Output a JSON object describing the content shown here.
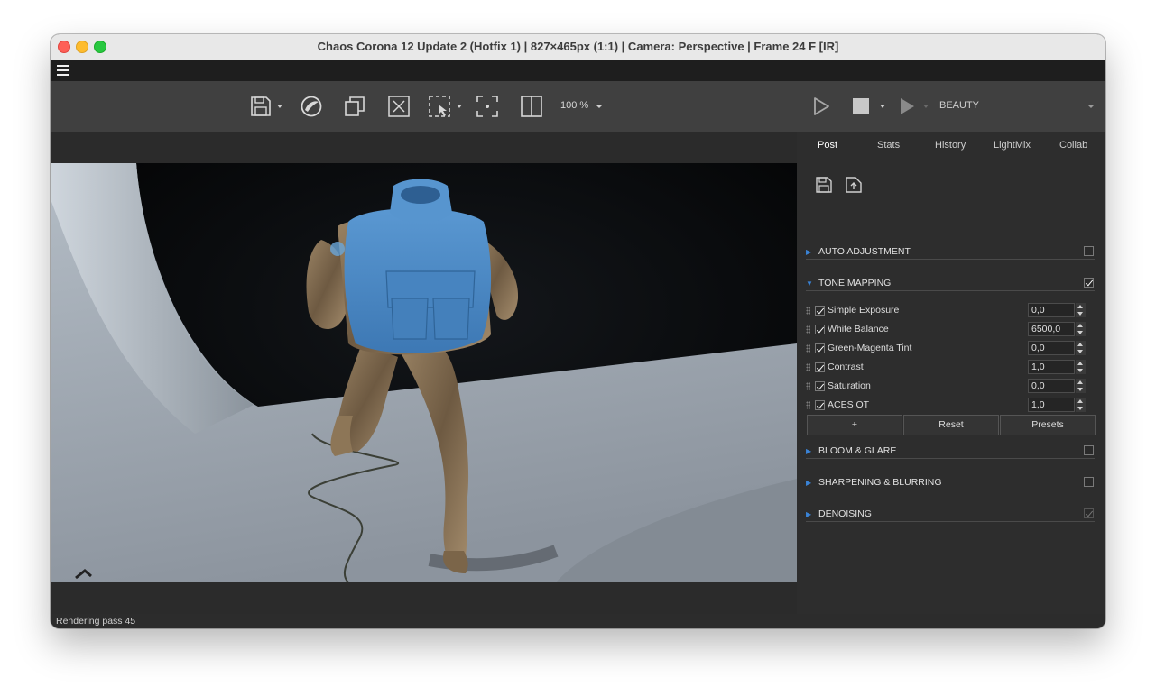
{
  "window": {
    "title": "Chaos Corona 12 Update 2 (Hotfix 1) | 827×465px (1:1) | Camera: Perspective | Frame 24 F [IR]"
  },
  "toolbar": {
    "zoom": "100 %",
    "pass": "BEAUTY",
    "icons": [
      "save-icon",
      "corona-logo-icon",
      "copy-icon",
      "clear-icon",
      "region-select-icon",
      "focus-icon",
      "compare-icon",
      "start-render-icon",
      "stop-render-icon",
      "resume-render-icon"
    ]
  },
  "panel": {
    "tabs": [
      {
        "label": "Post",
        "active": true
      },
      {
        "label": "Stats",
        "active": false
      },
      {
        "label": "History",
        "active": false
      },
      {
        "label": "LightMix",
        "active": false
      },
      {
        "label": "Collab",
        "active": false
      }
    ],
    "sections": {
      "auto_adjustment": {
        "title": "AUTO ADJUSTMENT",
        "enabled": false
      },
      "tone_mapping": {
        "title": "TONE MAPPING",
        "enabled": true
      },
      "bloom_glare": {
        "title": "BLOOM & GLARE",
        "enabled": false
      },
      "sharpening": {
        "title": "SHARPENING & BLURRING",
        "enabled": false
      },
      "denoising": {
        "title": "DENOISING",
        "enabled": true
      }
    },
    "tone_rows": [
      {
        "label": "Simple Exposure",
        "value": "0,0",
        "checked": true
      },
      {
        "label": "White Balance",
        "value": "6500,0",
        "checked": true
      },
      {
        "label": "Green-Magenta Tint",
        "value": "0,0",
        "checked": true
      },
      {
        "label": "Contrast",
        "value": "1,0",
        "checked": true
      },
      {
        "label": "Saturation",
        "value": "0,0",
        "checked": true
      },
      {
        "label": "ACES OT",
        "value": "1,0",
        "checked": true
      }
    ],
    "buttons": {
      "add": "+",
      "reset": "Reset",
      "presets": "Presets"
    }
  },
  "status": {
    "text": "Rendering pass 45"
  },
  "colors": {
    "accent": "#3a83d6",
    "vest": "#4b88c4",
    "camo": "#8a7356"
  }
}
